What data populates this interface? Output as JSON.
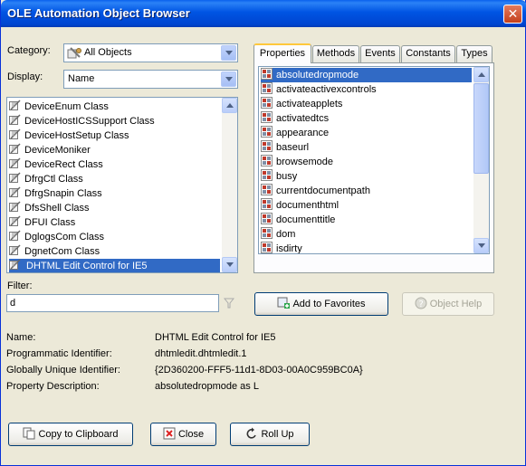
{
  "window": {
    "title": "OLE Automation Object Browser",
    "close_glyph": "✕"
  },
  "category": {
    "label": "Category:",
    "value": "All Objects"
  },
  "display": {
    "label": "Display:",
    "value": "Name"
  },
  "classes": {
    "items": [
      "DeviceEnum Class",
      "DeviceHostICSSupport Class",
      "DeviceHostSetup Class",
      "DeviceMoniker",
      "DeviceRect Class",
      "DfrgCtl Class",
      "DfrgSnapin Class",
      "DfsShell Class",
      "DFUI Class",
      "DglogsCom Class",
      "DgnetCom Class",
      "DHTML Edit Control for IE5"
    ],
    "selected_index": 11
  },
  "tabs": [
    "Properties",
    "Methods",
    "Events",
    "Constants",
    "Types"
  ],
  "properties": {
    "items": [
      "absolutedropmode",
      "activateactivexcontrols",
      "activateapplets",
      "activatedtcs",
      "appearance",
      "baseurl",
      "browsemode",
      "busy",
      "currentdocumentpath",
      "documenthtml",
      "documenttitle",
      "dom",
      "isdirty"
    ],
    "selected_index": 0
  },
  "filter": {
    "label": "Filter:",
    "value": "d"
  },
  "buttons": {
    "add_favorites": "Add to Favorites",
    "object_help": "Object Help",
    "copy_clipboard": "Copy to Clipboard",
    "close": "Close",
    "roll_up": "Roll Up"
  },
  "info": {
    "name_label": "Name:",
    "name_value": "DHTML Edit Control for IE5",
    "progid_label": "Programmatic Identifier:",
    "progid_value": "dhtmledit.dhtmledit.1",
    "guid_label": "Globally Unique Identifier:",
    "guid_value": "{2D360200-FFF5-11d1-8D03-00A0C959BC0A}",
    "desc_label": "Property Description:",
    "desc_value": "absolutedropmode as L"
  },
  "colors": {
    "selection": "#316ac5",
    "titlebar": "#0054e3",
    "tab_highlight": "#ffc83c"
  }
}
